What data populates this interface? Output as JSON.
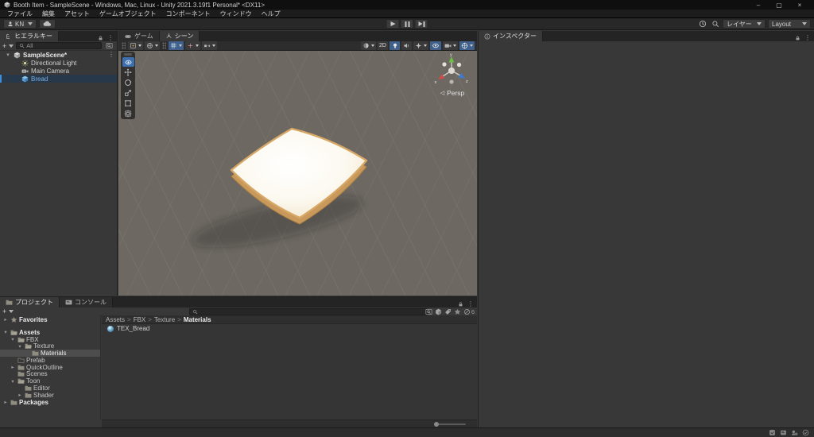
{
  "window": {
    "title": "Booth Item - SampleScene - Windows, Mac, Linux - Unity 2021.3.19f1 Personal* <DX11>",
    "minimize": "–",
    "maximize": "▢",
    "close": "×"
  },
  "menubar": {
    "items": [
      "ファイル",
      "編集",
      "アセット",
      "ゲームオブジェクト",
      "コンポーネント",
      "ウィンドウ",
      "ヘルプ"
    ]
  },
  "toolbar": {
    "account": "KN",
    "layers": "レイヤー",
    "layout": "Layout"
  },
  "hierarchy": {
    "tab": "ヒエラルキー",
    "search": "All",
    "rows": [
      {
        "label": "SampleScene*",
        "icon": "scene",
        "depth": 0,
        "arrow": "down",
        "bold": true,
        "kebab": true
      },
      {
        "label": "Directional Light",
        "icon": "light",
        "depth": 1,
        "arrow": "none"
      },
      {
        "label": "Main Camera",
        "icon": "camera",
        "depth": 1,
        "arrow": "none"
      },
      {
        "label": "Bread",
        "icon": "cube",
        "depth": 1,
        "arrow": "none",
        "selected": true
      }
    ]
  },
  "scene": {
    "tabs": [
      {
        "label": "ゲーム",
        "icon": "game",
        "active": false
      },
      {
        "label": "シーン",
        "icon": "sceneview",
        "active": true
      }
    ],
    "toolbar": {
      "two_d": "2D"
    },
    "gizmo": {
      "axis_x": "x",
      "axis_y": "y",
      "axis_z": "z",
      "persp": "Persp"
    }
  },
  "project": {
    "tabs": [
      {
        "label": "プロジェクト",
        "icon": "folder",
        "active": true
      },
      {
        "label": "コンソール",
        "icon": "console",
        "active": false
      }
    ],
    "breadcrumb": [
      "Assets",
      "FBX",
      "Texture",
      "Materials"
    ],
    "hidden_count": "6",
    "tree": [
      {
        "label": "Favorites",
        "depth": 0,
        "arrow": "right",
        "icon": "star",
        "bold": true,
        "gap_after": true
      },
      {
        "label": "Assets",
        "depth": 0,
        "arrow": "down",
        "icon": "folder-open",
        "bold": true
      },
      {
        "label": "FBX",
        "depth": 1,
        "arrow": "down",
        "icon": "folder-open"
      },
      {
        "label": "Texture",
        "depth": 2,
        "arrow": "down",
        "icon": "folder-open"
      },
      {
        "label": "Materials",
        "depth": 3,
        "arrow": "none",
        "icon": "folder",
        "selected": true
      },
      {
        "label": "Prefab",
        "depth": 1,
        "arrow": "none",
        "icon": "folder-empty"
      },
      {
        "label": "QuickOutline",
        "depth": 1,
        "arrow": "right",
        "icon": "folder"
      },
      {
        "label": "Scenes",
        "depth": 1,
        "arrow": "none",
        "icon": "folder"
      },
      {
        "label": "Toon",
        "depth": 1,
        "arrow": "down",
        "icon": "folder-open"
      },
      {
        "label": "Editor",
        "depth": 2,
        "arrow": "none",
        "icon": "folder"
      },
      {
        "label": "Shader",
        "depth": 2,
        "arrow": "right",
        "icon": "folder"
      },
      {
        "label": "Packages",
        "depth": 0,
        "arrow": "right",
        "icon": "folder",
        "bold": true
      }
    ],
    "items": [
      {
        "label": "TEX_Bread",
        "icon": "material"
      }
    ]
  },
  "inspector": {
    "tab": "インスペクター"
  },
  "colors": {
    "accent_blue": "#3e6fae",
    "selection_gray": "#4d4d4d",
    "scene_bg": "#6d6862",
    "bread_top": "#fdfbf2",
    "bread_crust": "#d7a765",
    "axis_x_red": "#c75048",
    "axis_y_green": "#6dbf45",
    "axis_z_blue": "#3c7ad1"
  }
}
